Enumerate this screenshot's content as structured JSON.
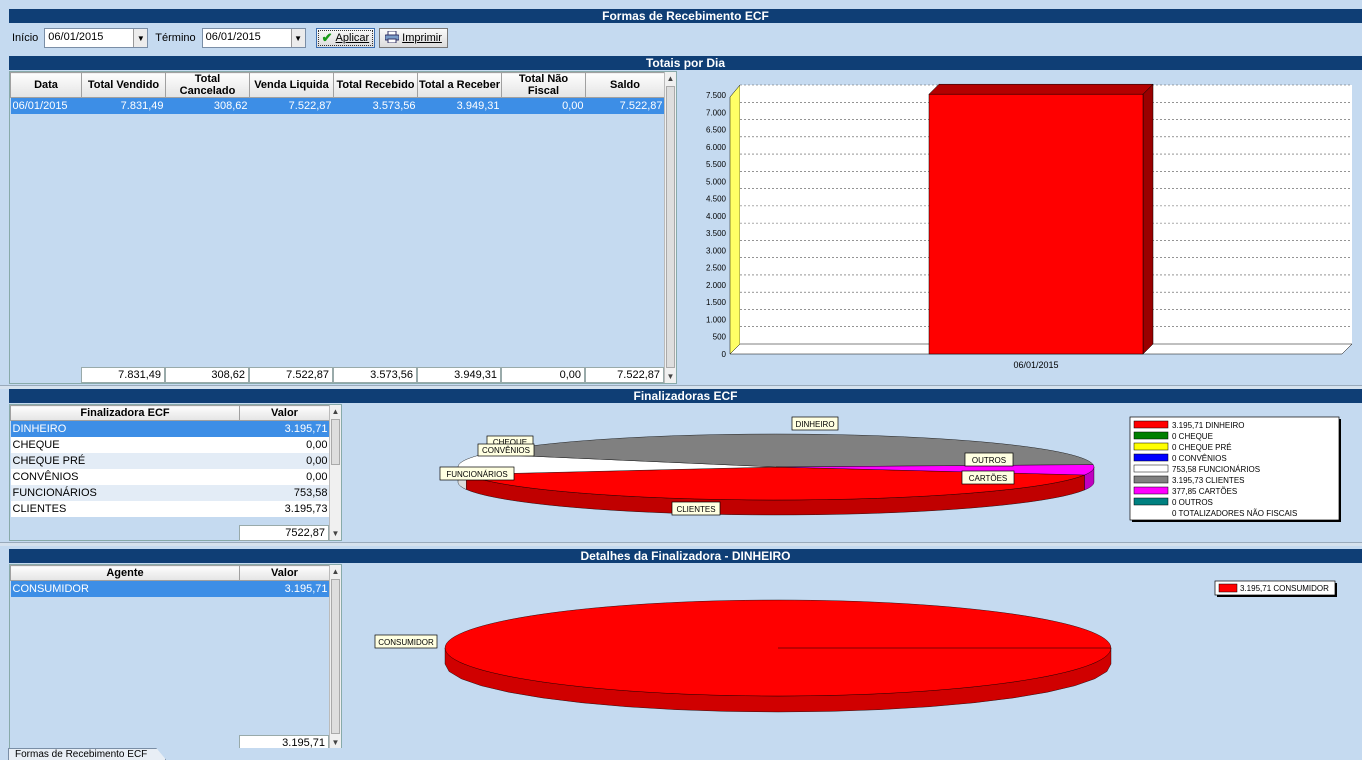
{
  "titles": {
    "main": "Formas de Recebimento ECF",
    "daily": "Totais por Dia",
    "finalizadoras": "Finalizadoras ECF",
    "detalhes": "Detalhes da Finalizadora - DINHEIRO"
  },
  "toolbar": {
    "inicio_label": "Início",
    "inicio_value": "06/01/2015",
    "termino_label": "Término",
    "termino_value": "06/01/2015",
    "apply_label": "Aplicar",
    "print_label": "Imprimir"
  },
  "daily_table": {
    "columns": [
      "Data",
      "Total Vendido",
      "Total Cancelado",
      "Venda Liquida",
      "Total Recebido",
      "Total a Receber",
      "Total Não Fiscal",
      "Saldo"
    ],
    "rows": [
      [
        "06/01/2015",
        "7.831,49",
        "308,62",
        "7.522,87",
        "3.573,56",
        "3.949,31",
        "0,00",
        "7.522,87"
      ]
    ],
    "totals": [
      "7.831,49",
      "308,62",
      "7.522,87",
      "3.573,56",
      "3.949,31",
      "0,00",
      "7.522,87"
    ]
  },
  "finalizadoras_table": {
    "columns": [
      "Finalizadora ECF",
      "Valor"
    ],
    "rows": [
      [
        "DINHEIRO",
        "3.195,71"
      ],
      [
        "CHEQUE",
        "0,00"
      ],
      [
        "CHEQUE PRÉ",
        "0,00"
      ],
      [
        "CONVÊNIOS",
        "0,00"
      ],
      [
        "FUNCIONÁRIOS",
        "753,58"
      ],
      [
        "CLIENTES",
        "3.195,73"
      ]
    ],
    "total": "7522,87"
  },
  "agentes_table": {
    "columns": [
      "Agente",
      "Valor"
    ],
    "rows": [
      [
        "CONSUMIDOR",
        "3.195,71"
      ]
    ],
    "total": "3.195,71"
  },
  "bar_chart": {
    "category": "06/01/2015",
    "ticks": [
      "7.500",
      "7.000",
      "6.500",
      "6.000",
      "5.500",
      "5.000",
      "4.500",
      "4.000",
      "3.500",
      "3.000",
      "2.500",
      "2.000",
      "1.500",
      "1.000",
      "500",
      "0"
    ]
  },
  "pie_labels": {
    "dinheiro": "DINHEIRO",
    "cheque": "CHEQUE",
    "convenios": "CONVÊNIOS",
    "funcionarios": "FUNCIONÁRIOS",
    "outros": "OUTROS",
    "cartoes": "CARTÕES",
    "clientes": "CLIENTES",
    "consumidor": "CONSUMIDOR"
  },
  "legend": [
    {
      "text": "3.195,71 DINHEIRO",
      "color": "#ff0000"
    },
    {
      "text": "0 CHEQUE",
      "color": "#008000"
    },
    {
      "text": "0 CHEQUE PRÉ",
      "color": "#ffff00"
    },
    {
      "text": "0 CONVÊNIOS",
      "color": "#0000ff"
    },
    {
      "text": "753,58 FUNCIONÁRIOS",
      "color": "#ffffff"
    },
    {
      "text": "3.195,73 CLIENTES",
      "color": "#808080"
    },
    {
      "text": "377,85 CARTÕES",
      "color": "#ff00ff"
    },
    {
      "text": "0 OUTROS",
      "color": "#008080"
    },
    {
      "text": "0 TOTALIZADORES NÃO FISCAIS",
      "color": "none"
    }
  ],
  "legend2": {
    "text": "3.195,71 CONSUMIDOR",
    "color": "#ff0000"
  },
  "chart_data": [
    {
      "type": "bar",
      "categories": [
        "06/01/2015"
      ],
      "values": [
        7522.87
      ],
      "ylim": [
        0,
        7500
      ]
    },
    {
      "type": "pie",
      "labels": [
        "DINHEIRO",
        "CHEQUE",
        "CHEQUE PRÉ",
        "CONVÊNIOS",
        "FUNCIONÁRIOS",
        "CLIENTES",
        "CARTÕES",
        "OUTROS",
        "TOTALIZADORES NÃO FISCAIS"
      ],
      "values": [
        3195.71,
        0,
        0,
        0,
        753.58,
        3195.73,
        377.85,
        0,
        0
      ]
    },
    {
      "type": "pie",
      "labels": [
        "CONSUMIDOR"
      ],
      "values": [
        3195.71
      ]
    }
  ],
  "status_tab": "Formas de Recebimento ECF"
}
